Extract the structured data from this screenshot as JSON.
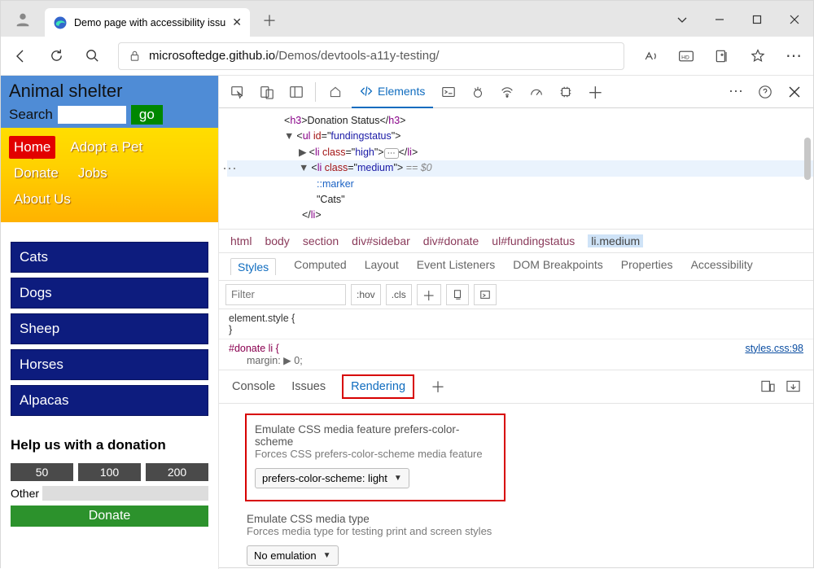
{
  "window": {
    "tab_title": "Demo page with accessibility issu"
  },
  "address": {
    "domain": "microsoftedge.github.io",
    "path": "/Demos/devtools-a11y-testing/"
  },
  "page": {
    "title": "Animal shelter",
    "search_label": "Search",
    "go_label": "go",
    "nav": [
      "Home",
      "Adopt a Pet",
      "Donate",
      "Jobs",
      "About Us"
    ],
    "categories": [
      "Cats",
      "Dogs",
      "Sheep",
      "Horses",
      "Alpacas"
    ],
    "help_heading": "Help us with a donation",
    "amounts": [
      "50",
      "100",
      "200"
    ],
    "other_label": "Other",
    "donate_label": "Donate"
  },
  "devtools": {
    "main_tabs": {
      "welcome": "Welcome",
      "elements": "Elements"
    },
    "dom": {
      "h3": "Donation Status",
      "ul_id": "fundingstatus",
      "li1_class": "high",
      "li2_class": "medium",
      "li2_comment": " == $0",
      "marker": "::marker",
      "text": "\"Cats\""
    },
    "crumbs": [
      "html",
      "body",
      "section",
      "div#sidebar",
      "div#donate",
      "ul#fundingstatus",
      "li.medium"
    ],
    "style_tabs": [
      "Styles",
      "Computed",
      "Layout",
      "Event Listeners",
      "DOM Breakpoints",
      "Properties",
      "Accessibility"
    ],
    "filter_placeholder": "Filter",
    "hov": ":hov",
    "cls": ".cls",
    "css": {
      "element_style_open": "element.style {",
      "close": "}",
      "rule": "#donate li {",
      "margin": "margin: ▶ 0;",
      "source": "styles.css:98"
    },
    "drawer_tabs": [
      "Console",
      "Issues",
      "Rendering"
    ],
    "rendering": {
      "title1": "Emulate CSS media feature prefers-color-scheme",
      "sub1": "Forces CSS prefers-color-scheme media feature",
      "select1": "prefers-color-scheme: light",
      "title2": "Emulate CSS media type",
      "sub2": "Forces media type for testing print and screen styles",
      "select2": "No emulation"
    }
  }
}
